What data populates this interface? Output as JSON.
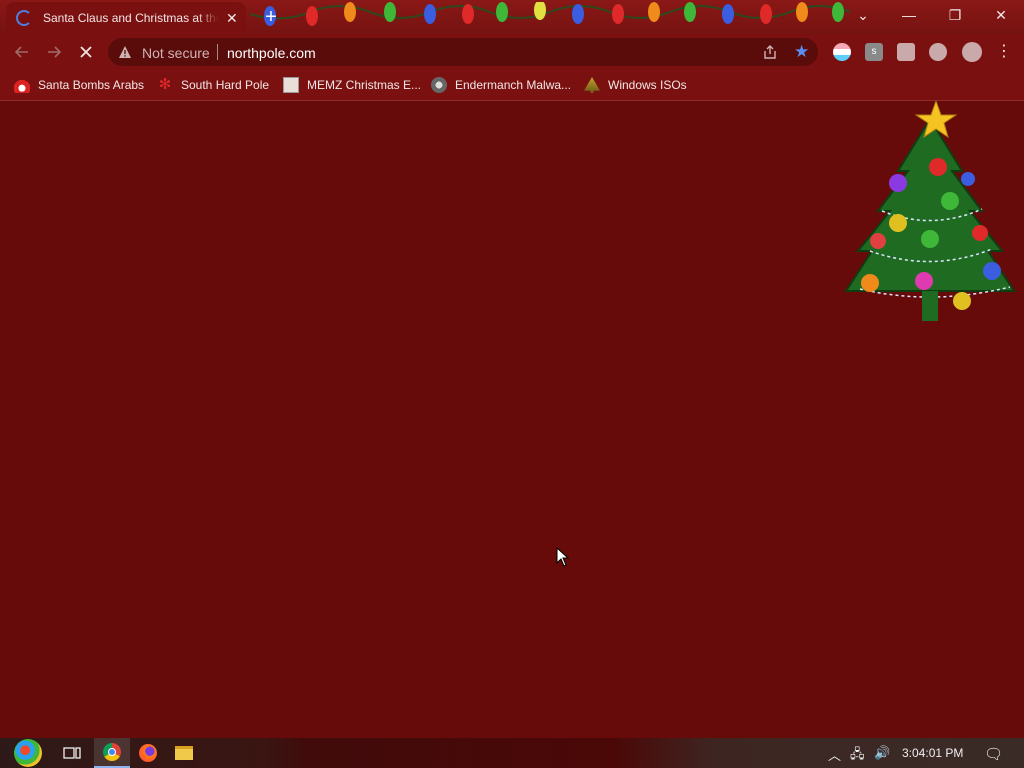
{
  "browser": {
    "tab": {
      "title": "Santa Claus and Christmas at the North Pole"
    },
    "window_controls": {
      "minimize": "—",
      "restore": "❐",
      "close": "✕",
      "tab_search": "⌄"
    }
  },
  "toolbar": {
    "security_label": "Not secure",
    "url": "northpole.com"
  },
  "bookmarks": [
    {
      "label": "Santa Bombs Arabs",
      "icon": "santa-icon"
    },
    {
      "label": "South Hard Pole",
      "icon": "snowflake-icon"
    },
    {
      "label": "MEMZ Christmas E...",
      "icon": "page-icon"
    },
    {
      "label": "Endermanch Malwa...",
      "icon": "raccoon-icon"
    },
    {
      "label": "Windows ISOs",
      "icon": "tree-icon"
    }
  ],
  "taskbar": {
    "clock": "3:04:01 PM",
    "apps": [
      "start-orb",
      "task-view",
      "chrome",
      "firefox",
      "file-explorer"
    ]
  },
  "colors": {
    "page_background": "#660b09",
    "chrome_frame": "#7a1110",
    "accent_blue": "#5b8ef0"
  }
}
